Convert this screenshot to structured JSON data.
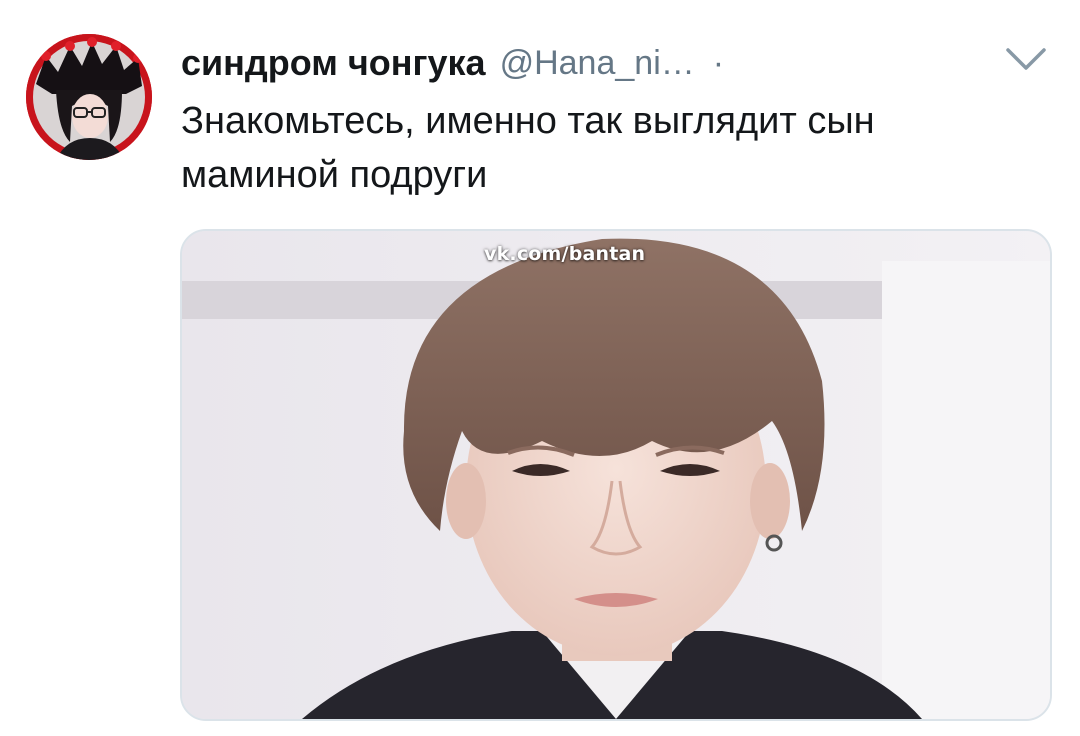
{
  "tweet": {
    "display_name": "синдром чонгука",
    "handle": "@Hana_ni…",
    "separator": "·",
    "text": "Знакомьтесь, именно так выглядит сын маминой подруги",
    "menu_icon": "chevron-down-icon"
  },
  "media": {
    "watermark": "vk.com/bantan"
  },
  "colors": {
    "text": "#14171a",
    "secondary": "#657786",
    "media_border": "#dbe3e9",
    "avatar_ring": "#c8141c"
  }
}
